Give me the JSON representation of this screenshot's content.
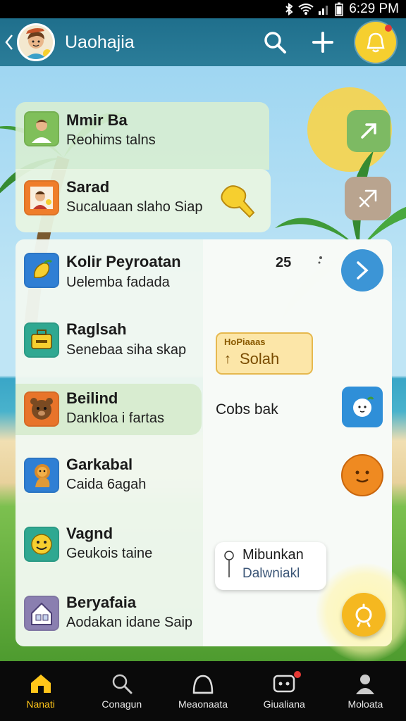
{
  "status_bar": {
    "time": "6:29 PM"
  },
  "app_bar": {
    "title": "Uaohajia"
  },
  "top_cards": [
    {
      "title": "Mmir Ba",
      "subtitle": "Reohims talns"
    },
    {
      "title": "Sarad",
      "subtitle": "Sucaluaan slaho Siap"
    }
  ],
  "list_items": [
    {
      "title": "Kolir Peyroatan",
      "subtitle": "Uelemba fadada"
    },
    {
      "title": "Raglsah",
      "subtitle": "Senebaa siha skap"
    },
    {
      "title": "Beilind",
      "subtitle": "Dankloa i fartas"
    },
    {
      "title": "Garkabal",
      "subtitle": "Caida 6agah"
    },
    {
      "title": "Vagnd",
      "subtitle": "Geukois taine"
    },
    {
      "title": "Beryafaia",
      "subtitle": "Aodakan idane Saip"
    }
  ],
  "panel": {
    "count": "25",
    "tag_small": "HoPiaaas",
    "tag_big": "Solah",
    "cobs_text": "Cobs bak",
    "tooltip_title": "Mibunkan",
    "tooltip_sub": "Dalwniakl"
  },
  "bottom_nav": [
    {
      "label": "Nanati"
    },
    {
      "label": "Conagun"
    },
    {
      "label": "Meaonaata"
    },
    {
      "label": "Giualiana"
    },
    {
      "label": "Moloata"
    }
  ],
  "colors": {
    "app_bar": "#1f6f8c",
    "accent": "#f6cf2f",
    "active_nav": "#ffc61a"
  }
}
